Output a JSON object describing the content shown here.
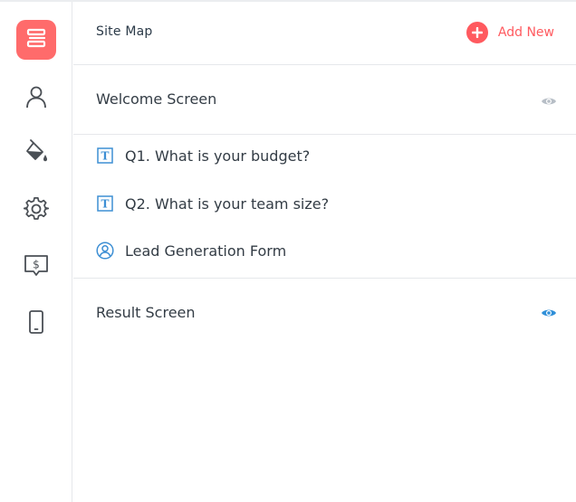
{
  "sidebar": {
    "items": [
      {
        "name": "site-map",
        "icon": "list-layout-icon",
        "active": true
      },
      {
        "name": "profile",
        "icon": "user-icon"
      },
      {
        "name": "design",
        "icon": "paint-bucket-icon"
      },
      {
        "name": "settings",
        "icon": "gear-icon"
      },
      {
        "name": "pricing",
        "icon": "dollar-screen-icon"
      },
      {
        "name": "mobile",
        "icon": "mobile-icon"
      }
    ],
    "accent_color": "#ff6b6b"
  },
  "header": {
    "title": "Site Map",
    "add_new_label": "Add New",
    "accent_color": "#ff5a5f"
  },
  "screens": {
    "welcome": {
      "label": "Welcome Screen",
      "eye_color": "#b7bec6"
    },
    "result": {
      "label": "Result Screen",
      "eye_color": "#2f8fd8"
    }
  },
  "questions": [
    {
      "label": "Q1. What is your budget?",
      "icon": "text-question-icon"
    },
    {
      "label": "Q2. What is your team size?",
      "icon": "text-question-icon"
    },
    {
      "label": "Lead Generation Form",
      "icon": "contact-form-icon"
    }
  ]
}
